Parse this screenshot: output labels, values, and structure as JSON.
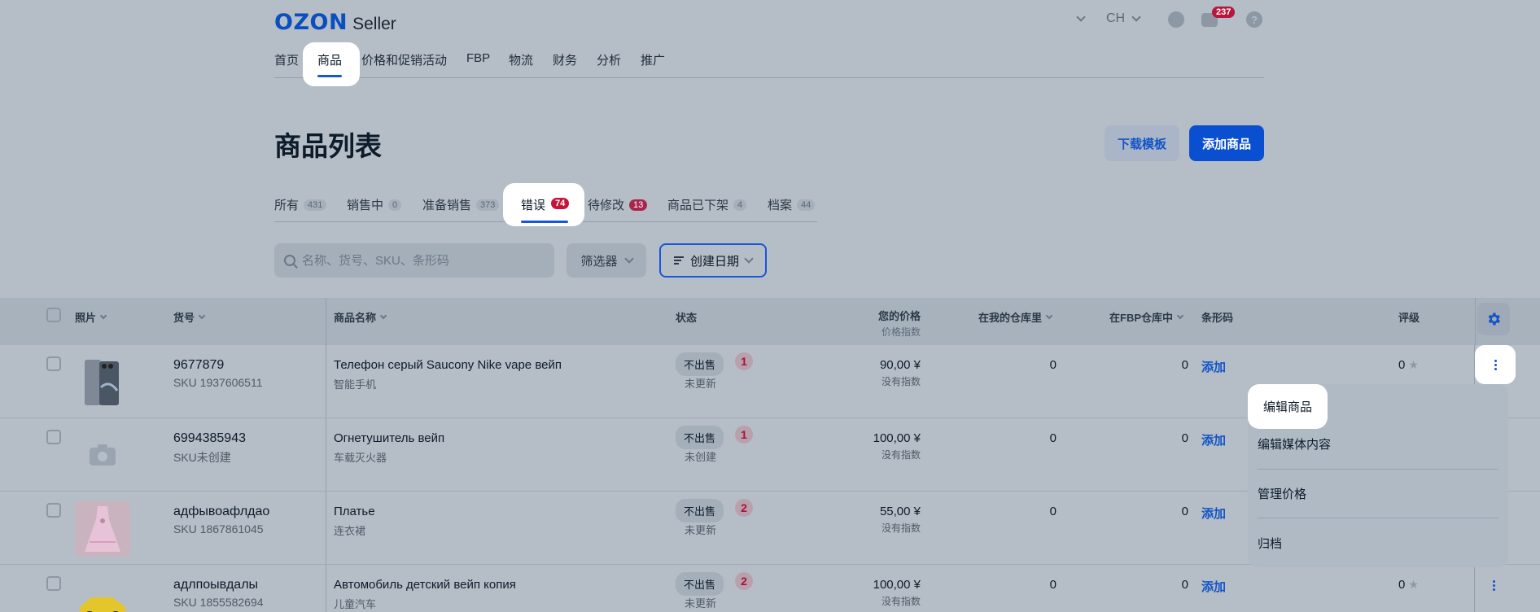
{
  "header": {
    "logo_brand": "OZON",
    "logo_product": "Seller",
    "lang": "CH",
    "notifications_count": "237",
    "help": "?"
  },
  "nav": {
    "items": [
      "首页",
      "商品",
      "价格和促销活动",
      "FBP",
      "物流",
      "财务",
      "分析",
      "推广"
    ],
    "active": "商品"
  },
  "page": {
    "title": "商品列表",
    "download_template": "下载模板",
    "add_product": "添加商品"
  },
  "status_tabs": [
    {
      "label": "所有",
      "count": "431"
    },
    {
      "label": "销售中",
      "count": "0"
    },
    {
      "label": "准备销售",
      "count": "373"
    },
    {
      "label": "错误",
      "count": "74"
    },
    {
      "label": "待修改",
      "count": "13"
    },
    {
      "label": "商品已下架",
      "count": "4"
    },
    {
      "label": "档案",
      "count": "44"
    }
  ],
  "toolbar": {
    "search_placeholder": "名称、货号、SKU、条形码",
    "filter_label": "筛选器",
    "sort_label": "创建日期"
  },
  "table": {
    "headers": {
      "photo": "照片",
      "article": "货号",
      "name": "商品名称",
      "status": "状态",
      "price": "您的价格",
      "price_sub": "价格指数",
      "my_stock": "在我的仓库里",
      "fbp_stock": "在FBP仓库中",
      "barcode": "条形码",
      "rating": "评级"
    },
    "rows": [
      {
        "article": "9677879",
        "sku": "SKU 1937606511",
        "name": "Телефон серый Saucony Nike vape вейп",
        "category": "智能手机",
        "status": "不出售",
        "errors": "1",
        "status_sub": "未更新",
        "price": "90,00 ¥",
        "price_index": "没有指数",
        "my_stock": "0",
        "fbp_stock": "0",
        "barcode_action": "添加",
        "rating": "0"
      },
      {
        "article": "6994385943",
        "sku": "SKU未创建",
        "name": "Огнетушитель вейп",
        "category": "车载灭火器",
        "status": "不出售",
        "errors": "1",
        "status_sub": "未创建",
        "price": "100,00 ¥",
        "price_index": "没有指数",
        "my_stock": "0",
        "fbp_stock": "0",
        "barcode_action": "添加",
        "rating": ""
      },
      {
        "article": "адфывоафлдао",
        "sku": "SKU 1867861045",
        "name": "Платье",
        "category": "连衣裙",
        "status": "不出售",
        "errors": "2",
        "status_sub": "未更新",
        "price": "55,00 ¥",
        "price_index": "没有指数",
        "my_stock": "0",
        "fbp_stock": "0",
        "barcode_action": "添加",
        "rating": ""
      },
      {
        "article": "адлпоывдалы",
        "sku": "SKU 1855582694",
        "name": "Автомобиль детский вейп копия",
        "category": "儿童汽车",
        "status": "不出售",
        "errors": "2",
        "status_sub": "未更新",
        "price": "100,00 ¥",
        "price_index": "没有指数",
        "my_stock": "0",
        "fbp_stock": "0",
        "barcode_action": "添加",
        "rating": "0"
      }
    ]
  },
  "context_menu": {
    "items": [
      "编辑商品",
      "编辑媒体内容",
      "管理价格",
      "归档"
    ]
  },
  "colors": {
    "accent": "#1658d9",
    "brand": "#0a4fbf",
    "error_badge": "#c5143a",
    "overlay": "#b5bdc6"
  }
}
